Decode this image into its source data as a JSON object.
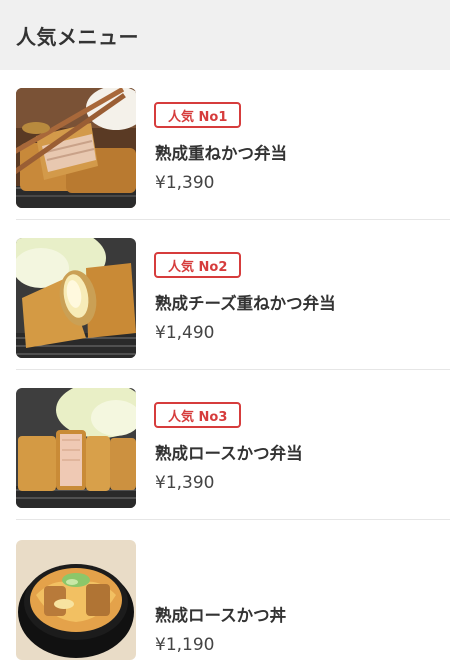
{
  "header": {
    "title": "人気メニュー"
  },
  "colors": {
    "accent": "#d63c3c",
    "header_bg": "#f0f0f0"
  },
  "items": [
    {
      "badge": "人気 No1",
      "name": "熟成重ねかつ弁当",
      "price": "¥1,390",
      "image": "layered-katsu-bento-photo"
    },
    {
      "badge": "人気 No2",
      "name": "熟成チーズ重ねかつ弁当",
      "price": "¥1,490",
      "image": "cheese-katsu-bento-photo"
    },
    {
      "badge": "人気 No3",
      "name": "熟成ロースかつ弁当",
      "price": "¥1,390",
      "image": "loin-katsu-bento-photo"
    },
    {
      "name": "熟成ロースかつ丼",
      "price": "¥1,190",
      "image": "loin-katsudon-photo"
    }
  ]
}
